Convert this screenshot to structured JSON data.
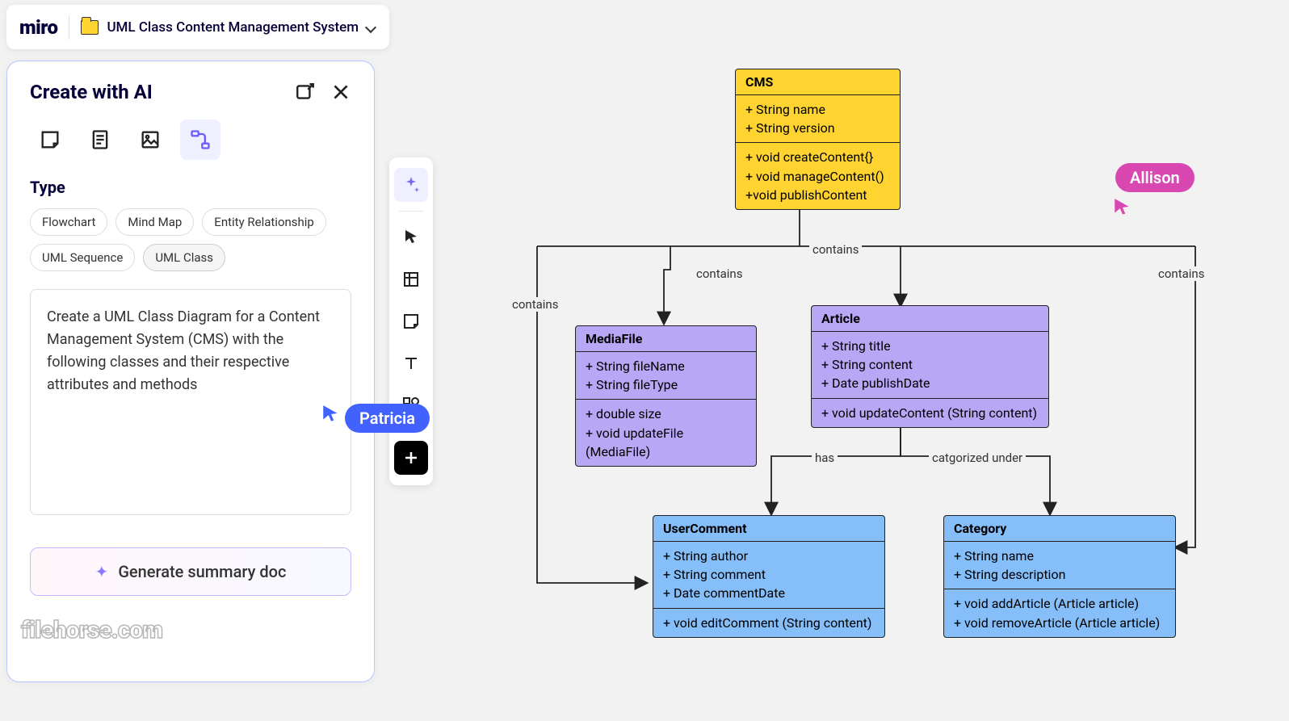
{
  "app": {
    "logo": "miro",
    "board_title": "UML Class Content Management System"
  },
  "ai_panel": {
    "title": "Create with AI",
    "type_label": "Type",
    "chips": [
      "Flowchart",
      "Mind Map",
      "Entity Relationship",
      "UML Sequence",
      "UML Class"
    ],
    "active_chip_index": 4,
    "tools": [
      "sticky-note",
      "document",
      "image",
      "diagram"
    ],
    "active_tool_index": 3,
    "prompt": "Create a UML Class Diagram for a Content Management System (CMS) with the following classes and their respective attributes and methods",
    "generate_label": "Generate summary doc"
  },
  "vtoolbar": {
    "items": [
      "ai-sparkle",
      "cursor",
      "frame",
      "sticky",
      "text",
      "shapes",
      "add"
    ]
  },
  "cursors": {
    "patricia": "Patricia",
    "allison": "Allison"
  },
  "diagram": {
    "cms": {
      "name": "CMS",
      "attrs": "+ String name\n+ String version",
      "methods": "+ void createContent{}\n+ void manageContent()\n+void publishContent"
    },
    "mediafile": {
      "name": "MediaFile",
      "attrs": "+ String fileName\n+ String fileType",
      "methods": "+ double size\n+ void updateFile (MediaFile)"
    },
    "article": {
      "name": "Article",
      "attrs": "+ String title\n+ String content\n+ Date publishDate",
      "methods": "+ void updateContent (String content)"
    },
    "usercomment": {
      "name": "UserComment",
      "attrs": "+ String author\n+ String comment\n+ Date commentDate",
      "methods": "+ void editComment (String content)"
    },
    "category": {
      "name": "Category",
      "attrs": "+ String name\n+ String description",
      "methods": "+ void addArticle (Article article)\n+ void removeArticle (Article article)"
    },
    "edges": {
      "e1": "contains",
      "e2": "contains",
      "e3": "contains",
      "e4": "contains",
      "e5": "has",
      "e6": "catgorized under"
    }
  },
  "watermark": "filehorse.com"
}
